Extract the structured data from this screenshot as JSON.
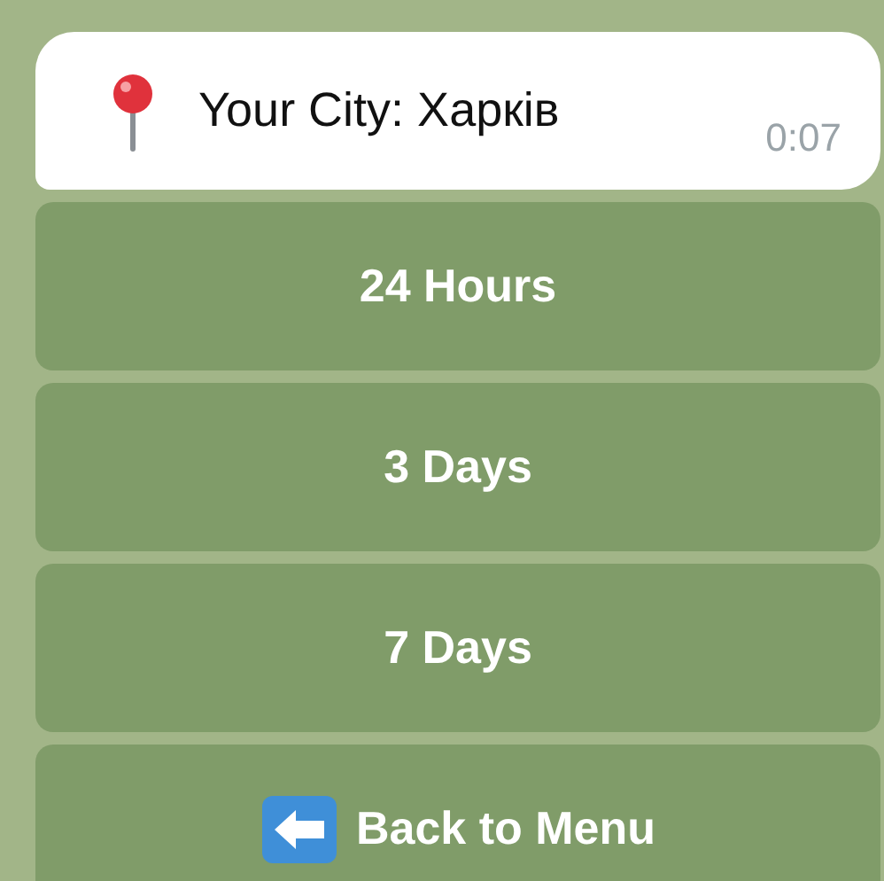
{
  "message": {
    "text": "Your City: Харків",
    "time": "0:07"
  },
  "buttons": [
    {
      "label": "24 Hours",
      "kind": "plain"
    },
    {
      "label": "3 Days",
      "kind": "plain"
    },
    {
      "label": "7 Days",
      "kind": "plain"
    },
    {
      "label": "Back to Menu",
      "kind": "back"
    }
  ]
}
